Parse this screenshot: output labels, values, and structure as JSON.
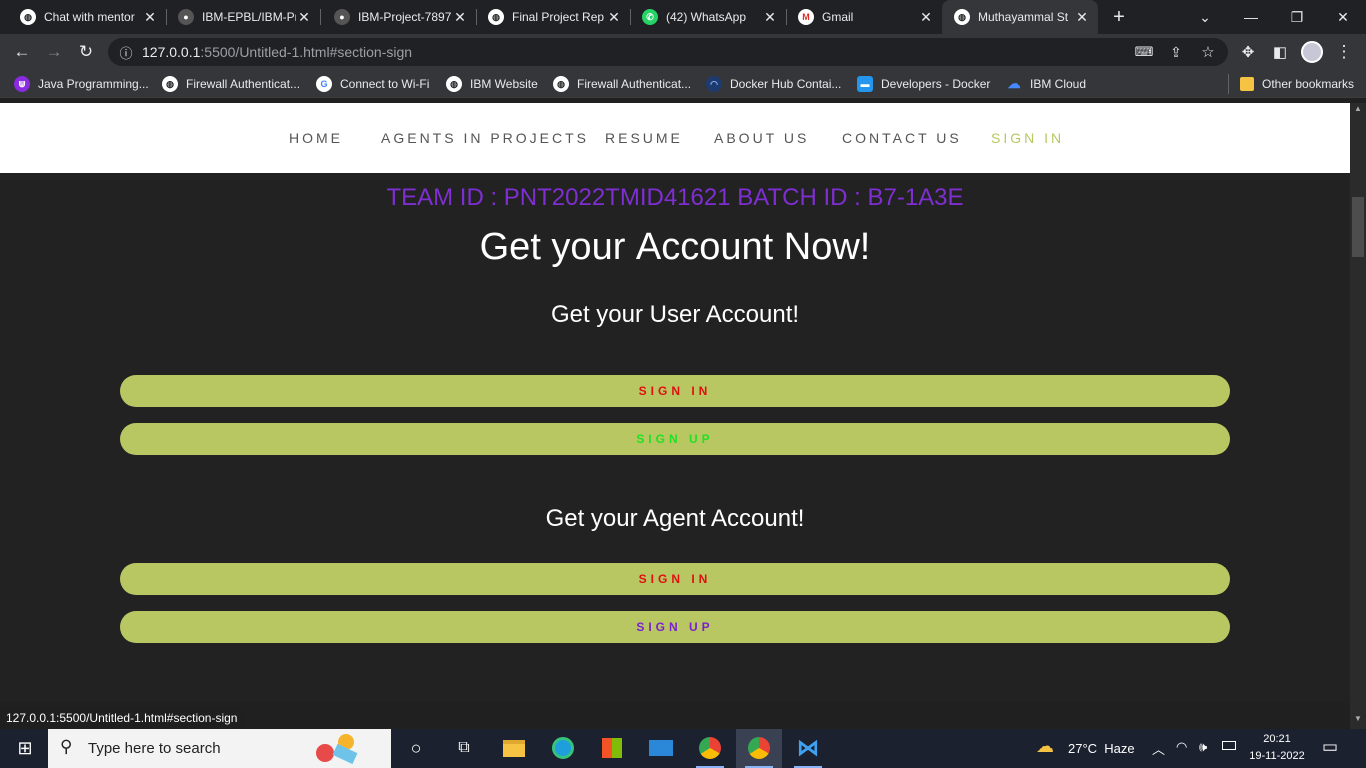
{
  "browser": {
    "tabs": [
      {
        "title": "Chat with mentor",
        "icon": "globe-icon"
      },
      {
        "title": "IBM-EPBL/IBM-Pr",
        "icon": "github-icon"
      },
      {
        "title": "IBM-Project-7897",
        "icon": "github-icon"
      },
      {
        "title": "Final Project Rep",
        "icon": "globe-icon"
      },
      {
        "title": "(42) WhatsApp",
        "icon": "whatsapp-icon"
      },
      {
        "title": "Gmail",
        "icon": "gmail-icon"
      },
      {
        "title": "Muthayammal St",
        "icon": "globe-icon",
        "active": true
      }
    ],
    "address": {
      "host": "127.0.0.1",
      "rest": ":5500/Untitled-1.html#section-sign"
    },
    "bookmarks": [
      {
        "label": "Java Programming...",
        "color": "#8a2be2"
      },
      {
        "label": "Firewall Authenticat...",
        "color": "#ffffff"
      },
      {
        "label": "Connect to Wi-Fi",
        "color": "#ffffff"
      },
      {
        "label": "IBM Website",
        "color": "#ffffff"
      },
      {
        "label": "Firewall Authenticat...",
        "color": "#ffffff"
      },
      {
        "label": "Docker Hub Contai...",
        "color": "#1d63ed"
      },
      {
        "label": "Developers - Docker",
        "color": "#2496ed"
      },
      {
        "label": "IBM Cloud",
        "color": "#4589ff"
      },
      {
        "label": "Other bookmarks",
        "color": "#f6c343"
      }
    ]
  },
  "page": {
    "nav": [
      "HOME",
      "AGENTS IN PROJECTS",
      "RESUME",
      "ABOUT US",
      "CONTACT US",
      "SIGN IN"
    ],
    "nav_active_color": "#b9c763",
    "team_line": "TEAM ID : PNT2022TMID41621 BATCH ID : B7-1A3E",
    "heading": {
      "light": "Get your ",
      "bold": "Account Now!"
    },
    "user_heading": {
      "light": "Get your ",
      "bold": "User Account!"
    },
    "agent_heading": {
      "light": "Get your ",
      "bold": "Agent Account!"
    },
    "user_buttons": [
      {
        "label": "SIGN IN",
        "color": "#e01010"
      },
      {
        "label": "SIGN UP",
        "color": "#22e022"
      }
    ],
    "agent_buttons": [
      {
        "label": "SIGN IN",
        "color": "#e01010"
      },
      {
        "label": "SIGN UP",
        "color": "#7a1fd1"
      }
    ],
    "button_color": "#b9c763"
  },
  "status_bar": "127.0.0.1:5500/Untitled-1.html#section-sign",
  "taskbar": {
    "search_placeholder": "Type here to search",
    "weather": "27°C  Haze",
    "time": "20:21",
    "date": "19-11-2022"
  }
}
